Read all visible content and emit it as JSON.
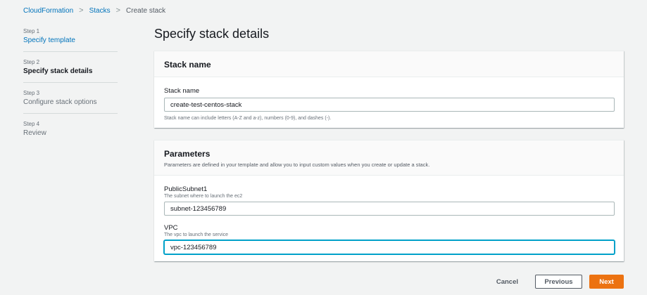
{
  "breadcrumb": {
    "items": [
      {
        "label": "CloudFormation"
      },
      {
        "label": "Stacks"
      },
      {
        "label": "Create stack"
      }
    ],
    "separator": ">"
  },
  "steps": [
    {
      "number": "Step 1",
      "label": "Specify template",
      "state": "link"
    },
    {
      "number": "Step 2",
      "label": "Specify stack details",
      "state": "active"
    },
    {
      "number": "Step 3",
      "label": "Configure stack options",
      "state": "disabled"
    },
    {
      "number": "Step 4",
      "label": "Review",
      "state": "disabled"
    }
  ],
  "page": {
    "title": "Specify stack details"
  },
  "stack_name_panel": {
    "heading": "Stack name",
    "field_label": "Stack name",
    "value": "create-test-centos-stack",
    "hint": "Stack name can include letters (A-Z and a-z), numbers (0-9), and dashes (-)."
  },
  "parameters_panel": {
    "heading": "Parameters",
    "description": "Parameters are defined in your template and allow you to input custom values when you create or update a stack.",
    "fields": [
      {
        "label": "PublicSubnet1",
        "description": "The subnet where to launch the ec2",
        "value": "subnet-123456789"
      },
      {
        "label": "VPC",
        "description": "The vpc to launch the service",
        "value": "vpc-123456789"
      }
    ]
  },
  "actions": {
    "cancel": "Cancel",
    "previous": "Previous",
    "next": "Next"
  },
  "colors": {
    "link": "#0073bb",
    "primary": "#ec7211",
    "focus": "#00a1c9",
    "background": "#f2f3f3"
  }
}
